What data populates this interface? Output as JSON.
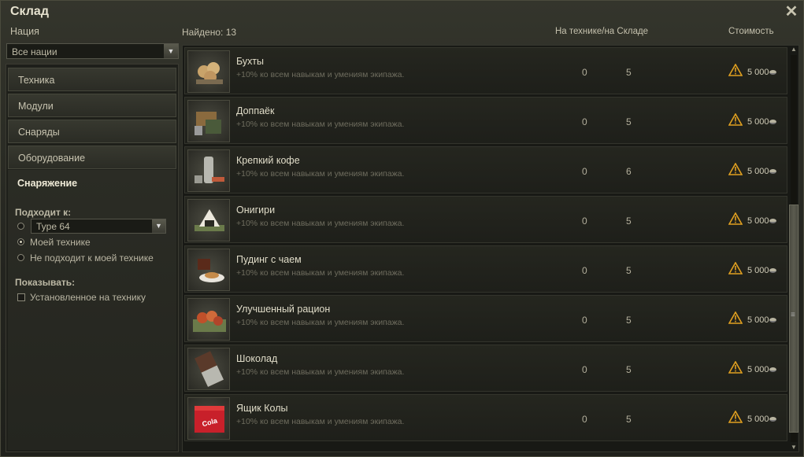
{
  "window": {
    "title": "Склад",
    "close_icon": "close-icon"
  },
  "filters": {
    "nation_label": "Нация",
    "nation_value": "Все нации",
    "categories": [
      "Техника",
      "Модули",
      "Снаряды",
      "Оборудование",
      "Снаряжение"
    ],
    "active_category": "Снаряжение",
    "fits_label": "Подходит к:",
    "fits_vehicle": "Type 64",
    "fits_options": [
      "Моей технике",
      "Не подходит к моей технике"
    ],
    "fits_selected": "Моей технике",
    "show_label": "Показывать:",
    "show_installed": "Установленное на технику"
  },
  "list_header": {
    "found": "Найдено: 13",
    "col_count": "На технике/на Складе",
    "col_price": "Стоимость"
  },
  "items": [
    {
      "name": "Бухты",
      "desc": "+10% ко всем навыкам и умениям экипажа.",
      "on_vehicle": "0",
      "in_stock": "5",
      "price": "5 000",
      "icon": "buns-icon"
    },
    {
      "name": "Доппаёк",
      "desc": "+10% ко всем навыкам и умениям экипажа.",
      "on_vehicle": "0",
      "in_stock": "5",
      "price": "5 000",
      "icon": "ration-box-icon"
    },
    {
      "name": "Крепкий кофе",
      "desc": "+10% ко всем навыкам и умениям экипажа.",
      "on_vehicle": "0",
      "in_stock": "6",
      "price": "5 000",
      "icon": "coffee-thermos-icon"
    },
    {
      "name": "Онигири",
      "desc": "+10% ко всем навыкам и умениям экипажа.",
      "on_vehicle": "0",
      "in_stock": "5",
      "price": "5 000",
      "icon": "onigiri-icon"
    },
    {
      "name": "Пудинг с чаем",
      "desc": "+10% ко всем навыкам и умениям экипажа.",
      "on_vehicle": "0",
      "in_stock": "5",
      "price": "5 000",
      "icon": "pudding-tea-icon"
    },
    {
      "name": "Улучшенный рацион",
      "desc": "+10% ко всем навыкам и умениям экипажа.",
      "on_vehicle": "0",
      "in_stock": "5",
      "price": "5 000",
      "icon": "improved-ration-icon"
    },
    {
      "name": "Шоколад",
      "desc": "+10% ко всем навыкам и умениям экипажа.",
      "on_vehicle": "0",
      "in_stock": "5",
      "price": "5 000",
      "icon": "chocolate-icon"
    },
    {
      "name": "Ящик Колы",
      "desc": "+10% ко всем навыкам и умениям экипажа.",
      "on_vehicle": "0",
      "in_stock": "5",
      "price": "5 000",
      "icon": "cola-box-icon",
      "icon_text": "Cola"
    }
  ],
  "colors": {
    "warning": "#e0a020",
    "accent_text": "#e0dcc8"
  }
}
